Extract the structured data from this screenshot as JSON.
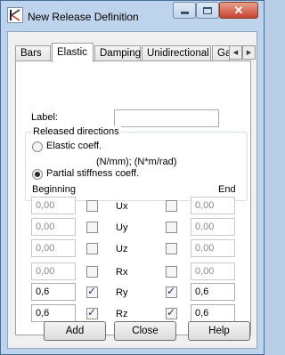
{
  "window": {
    "title": "New Release Definition"
  },
  "tabs": [
    {
      "label": "Bars",
      "active": false
    },
    {
      "label": "Elastic",
      "active": true
    },
    {
      "label": "Damping",
      "active": false
    },
    {
      "label": "Unidirectional",
      "active": false
    },
    {
      "label": "Ga",
      "active": false
    }
  ],
  "form": {
    "label_caption": "Label:",
    "label_value": "",
    "group_title": "Released directions",
    "options": [
      {
        "label": "Elastic coeff.",
        "selected": false
      },
      {
        "label": "Partial stiffness coeff.",
        "selected": true
      }
    ],
    "units": "(N/mm);  (N*m/rad)",
    "beginning_label": "Beginning",
    "end_label": "End",
    "rows": [
      {
        "dir": "Ux",
        "begin": "0,00",
        "end": "0,00",
        "begin_checked": false,
        "end_checked": false
      },
      {
        "dir": "Uy",
        "begin": "0,00",
        "end": "0,00",
        "begin_checked": false,
        "end_checked": false
      },
      {
        "dir": "Uz",
        "begin": "0,00",
        "end": "0,00",
        "begin_checked": false,
        "end_checked": false
      },
      {
        "dir": "Rx",
        "begin": "0,00",
        "end": "0,00",
        "begin_checked": false,
        "end_checked": false
      },
      {
        "dir": "Ry",
        "begin": "0,6",
        "end": "0,6",
        "begin_checked": true,
        "end_checked": true
      },
      {
        "dir": "Rz",
        "begin": "0,6",
        "end": "0,6",
        "begin_checked": true,
        "end_checked": true
      }
    ]
  },
  "buttons": {
    "add": "Add",
    "close": "Close",
    "help": "Help"
  },
  "icons": {
    "app": "release-app-icon",
    "minimize": "minimize-icon",
    "maximize": "maximize-icon",
    "close": "close-icon"
  }
}
